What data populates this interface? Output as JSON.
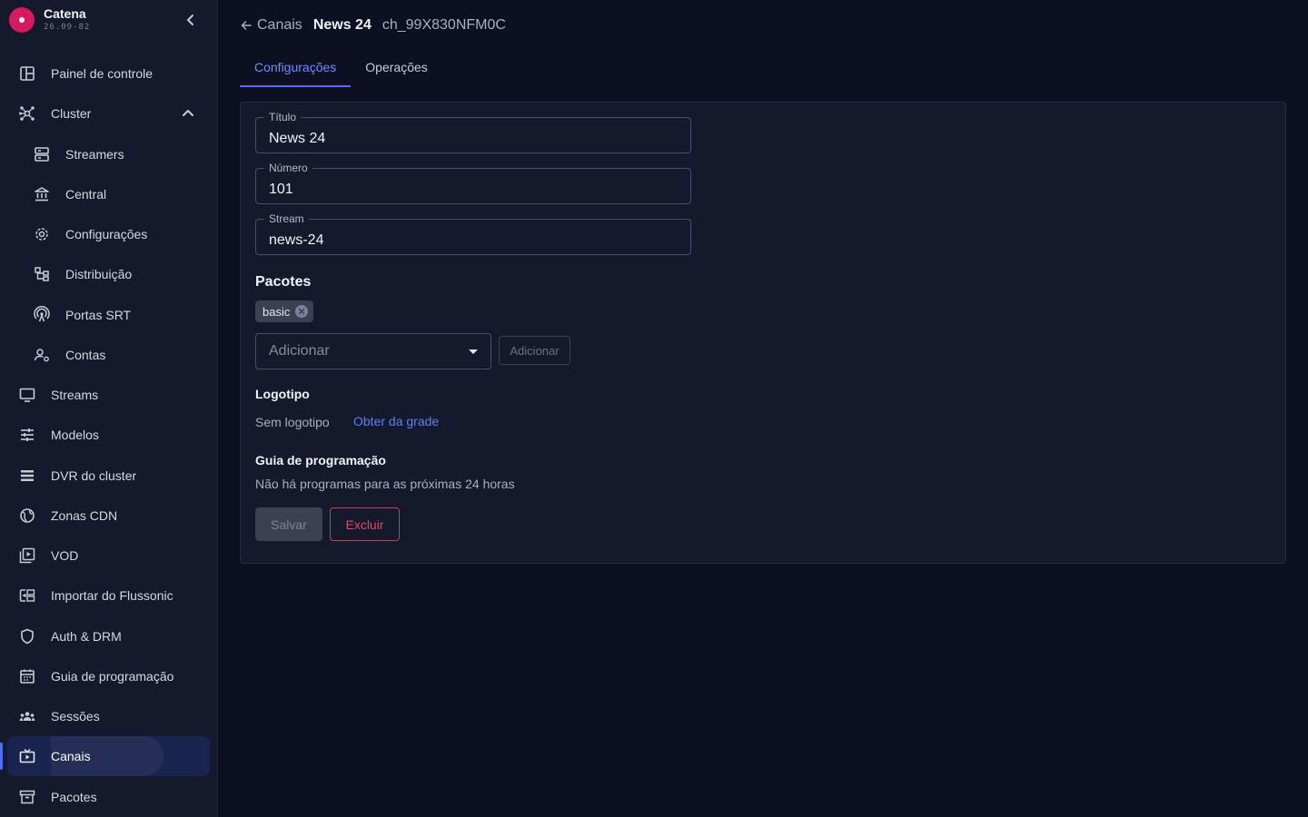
{
  "brand": {
    "name": "Catena",
    "version": "26.09-82"
  },
  "sidebar": {
    "items": [
      {
        "label": "Painel de controle",
        "icon": "dashboard-icon"
      },
      {
        "label": "Cluster",
        "icon": "cluster-icon",
        "expanded": true
      },
      {
        "label": "Streamers",
        "icon": "server-icon"
      },
      {
        "label": "Central",
        "icon": "bank-icon"
      },
      {
        "label": "Configurações",
        "icon": "gear-icon"
      },
      {
        "label": "Distribuição",
        "icon": "hierarchy-icon"
      },
      {
        "label": "Portas SRT",
        "icon": "antenna-icon"
      },
      {
        "label": "Contas",
        "icon": "users-gear-icon"
      },
      {
        "label": "Streams",
        "icon": "monitor-icon"
      },
      {
        "label": "Modelos",
        "icon": "sliders-icon"
      },
      {
        "label": "DVR do cluster",
        "icon": "list-icon"
      },
      {
        "label": "Zonas CDN",
        "icon": "globe-icon"
      },
      {
        "label": "VOD",
        "icon": "video-library-icon"
      },
      {
        "label": "Importar do Flussonic",
        "icon": "import-icon"
      },
      {
        "label": "Auth & DRM",
        "icon": "shield-icon"
      },
      {
        "label": "Guia de programação",
        "icon": "calendar-icon"
      },
      {
        "label": "Sessões",
        "icon": "group-icon"
      },
      {
        "label": "Canais",
        "icon": "tv-icon",
        "active": true
      },
      {
        "label": "Pacotes",
        "icon": "archive-icon"
      }
    ]
  },
  "breadcrumb": {
    "back": "Canais",
    "title": "News 24",
    "id": "ch_99X830NFM0C"
  },
  "tabs": [
    {
      "label": "Configurações",
      "active": true
    },
    {
      "label": "Operações",
      "active": false
    }
  ],
  "form": {
    "title": {
      "label": "Título",
      "value": "News 24"
    },
    "number": {
      "label": "Número",
      "value": "101"
    },
    "stream": {
      "label": "Stream",
      "value": "news-24"
    }
  },
  "packages": {
    "heading": "Pacotes",
    "chips": [
      "basic"
    ],
    "select_placeholder": "Adicionar",
    "add_button": "Adicionar"
  },
  "logo": {
    "heading": "Logotipo",
    "status": "Sem logotipo",
    "link": "Obter da grade"
  },
  "epg": {
    "heading": "Guia de programação",
    "message": "Não há programas para as próximas 24 horas"
  },
  "actions": {
    "save": "Salvar",
    "delete": "Excluir"
  },
  "colors": {
    "accent": "#4f6ef7",
    "brand": "#d8195d",
    "danger": "#e04863",
    "background": "#0d1020",
    "panel": "#141a2b"
  }
}
